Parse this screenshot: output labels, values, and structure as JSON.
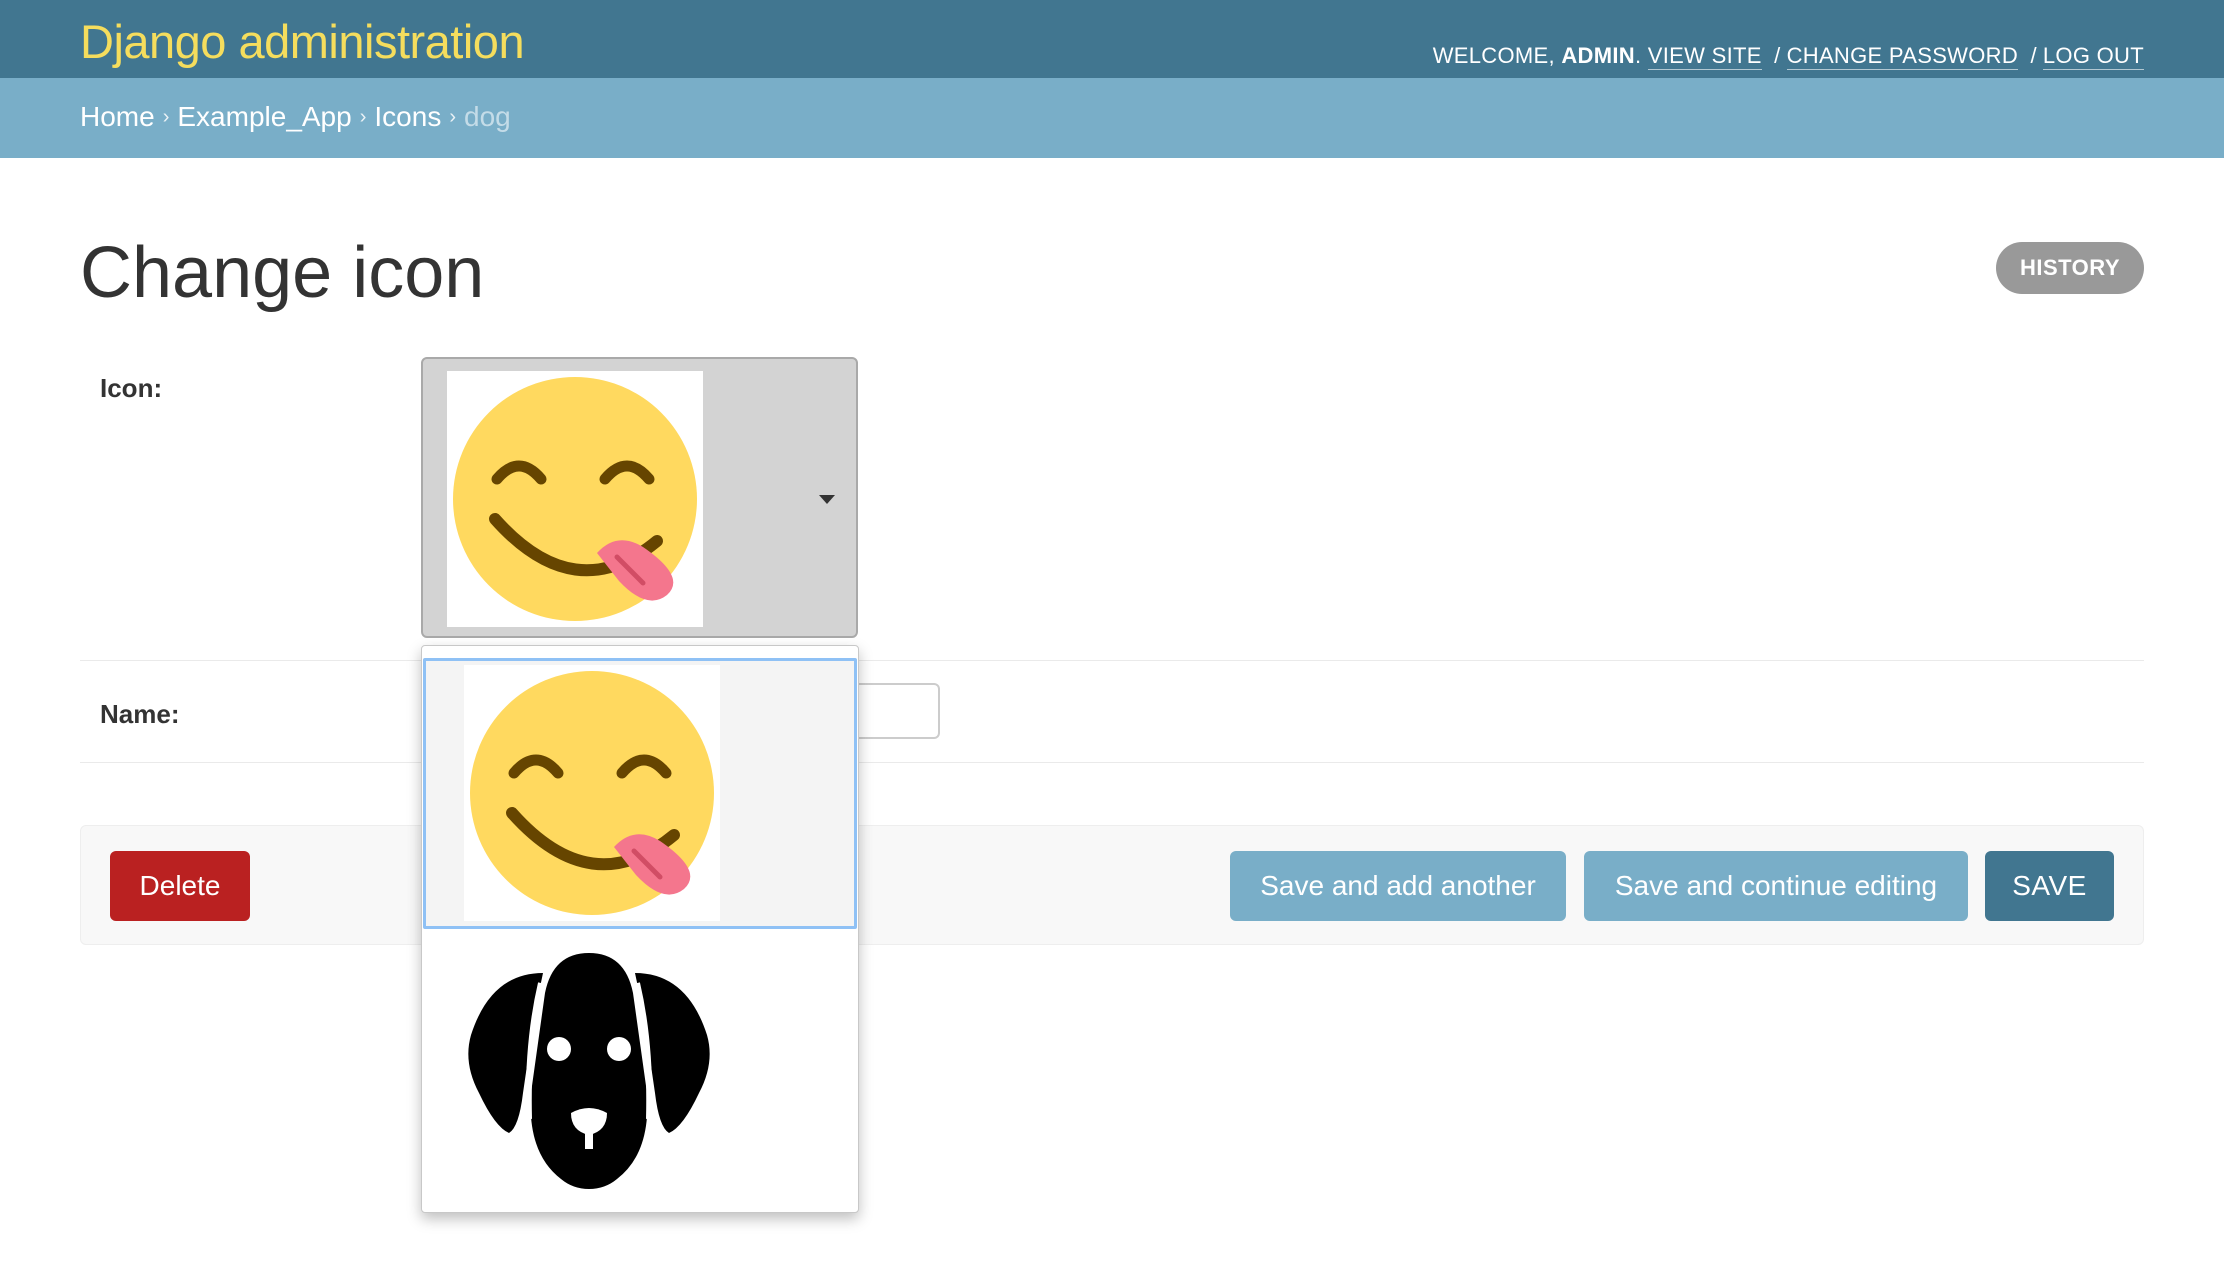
{
  "header": {
    "site_name": "Django administration",
    "welcome_prefix": "WELCOME,",
    "username": "ADMIN",
    "username_suffix": ".",
    "view_site": "VIEW SITE",
    "change_password": "CHANGE PASSWORD",
    "log_out": "LOG OUT",
    "separator": "/"
  },
  "breadcrumbs": {
    "items": [
      "Home",
      "Example_App",
      "Icons"
    ],
    "current": "dog",
    "arrow": "›"
  },
  "page": {
    "title": "Change icon",
    "history_label": "HISTORY"
  },
  "form": {
    "icon_label": "Icon:",
    "name_label": "Name:",
    "icon_selected": "smiling-face-with-tongue",
    "icon_options": [
      "smiling-face-with-tongue",
      "dog"
    ]
  },
  "actions": {
    "delete": "Delete",
    "save_add_another": "Save and add another",
    "save_continue": "Save and continue editing",
    "save": "SAVE"
  },
  "colors": {
    "header_bg": "#417690",
    "breadcrumb_bg": "#79aec8",
    "brand_text": "#f5dd5d",
    "delete_bg": "#ba2121",
    "secondary_btn_bg": "#79aec8",
    "primary_btn_bg": "#417690",
    "focus_ring": "#8fc1f5"
  }
}
